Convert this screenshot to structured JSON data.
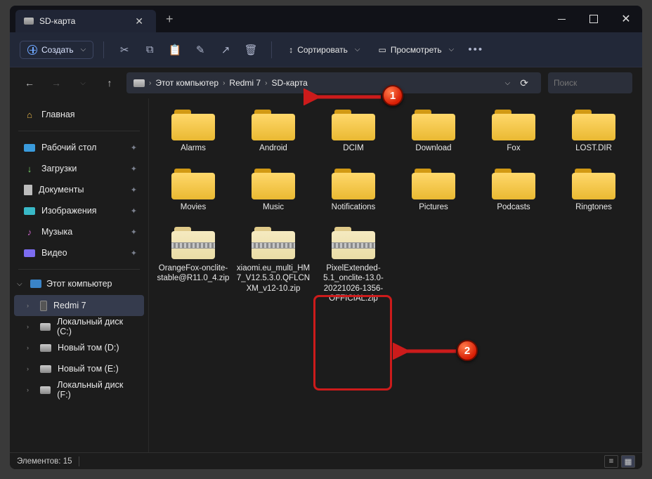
{
  "window": {
    "tab_title": "SD-карта"
  },
  "toolbar": {
    "create": "Создать",
    "sort": "Сортировать",
    "view": "Просмотреть"
  },
  "breadcrumb": [
    "Этот компьютер",
    "Redmi 7",
    "SD-карта"
  ],
  "search": {
    "placeholder": "Поиск"
  },
  "sidebar": {
    "home": "Главная",
    "quick": [
      {
        "label": "Рабочий стол",
        "icon": "desktop"
      },
      {
        "label": "Загрузки",
        "icon": "down"
      },
      {
        "label": "Документы",
        "icon": "doc"
      },
      {
        "label": "Изображения",
        "icon": "pic"
      },
      {
        "label": "Музыка",
        "icon": "music"
      },
      {
        "label": "Видео",
        "icon": "video"
      }
    ],
    "this_pc": "Этот компьютер",
    "devices": [
      {
        "label": "Redmi 7",
        "icon": "phone",
        "selected": true
      },
      {
        "label": "Локальный диск (C:)",
        "icon": "drive"
      },
      {
        "label": "Новый том (D:)",
        "icon": "drive"
      },
      {
        "label": "Новый том (E:)",
        "icon": "drive"
      },
      {
        "label": "Локальный диск (F:)",
        "icon": "drive"
      }
    ]
  },
  "files": [
    {
      "name": "Alarms",
      "type": "folder"
    },
    {
      "name": "Android",
      "type": "folder"
    },
    {
      "name": "DCIM",
      "type": "folder"
    },
    {
      "name": "Download",
      "type": "folder"
    },
    {
      "name": "Fox",
      "type": "folder"
    },
    {
      "name": "LOST.DIR",
      "type": "folder"
    },
    {
      "name": "Movies",
      "type": "folder"
    },
    {
      "name": "Music",
      "type": "folder"
    },
    {
      "name": "Notifications",
      "type": "folder"
    },
    {
      "name": "Pictures",
      "type": "folder"
    },
    {
      "name": "Podcasts",
      "type": "folder"
    },
    {
      "name": "Ringtones",
      "type": "folder"
    },
    {
      "name": "OrangeFox-onclite-stable@R11.0_4.zip",
      "type": "zip"
    },
    {
      "name": "xiaomi.eu_multi_HM7_V12.5.3.0.QFLCNXM_v12-10.zip",
      "type": "zip"
    },
    {
      "name": "PixelExtended-5.1_onclite-13.0-20221026-1356-OFFICIAL.zip",
      "type": "zip",
      "highlighted": true
    }
  ],
  "status": {
    "count_label": "Элементов:",
    "count": "15"
  },
  "annotations": {
    "badge1": "1",
    "badge2": "2"
  }
}
